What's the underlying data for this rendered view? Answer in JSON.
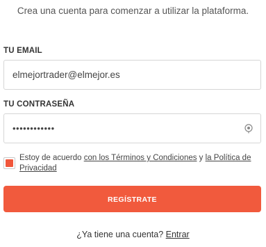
{
  "subtitle": "Crea una cuenta para comenzar a utilizar la plataforma.",
  "email": {
    "label": "TU EMAIL",
    "value": "elmejortrader@elmejor.es"
  },
  "password": {
    "label": "TU CONTRASEÑA",
    "value": "••••••••••••",
    "toggle_icon": "eye-icon"
  },
  "terms": {
    "checked": true,
    "prefix": "Estoy de acuerdo ",
    "terms_link": "con los Términos y Condiciones",
    "middle": " y ",
    "privacy_link": "la Política de Privacidad"
  },
  "submit_label": "REGÍSTRATE",
  "footer": {
    "question": "¿Ya tiene una cuenta? ",
    "login_link": "Entrar"
  },
  "colors": {
    "accent": "#f15a3d",
    "text": "#333333",
    "border": "#d6d6d6"
  }
}
